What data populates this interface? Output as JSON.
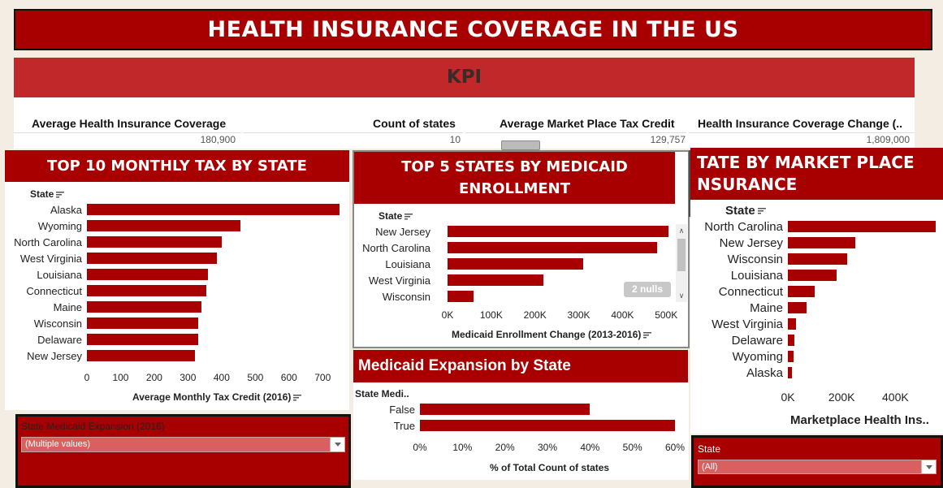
{
  "title": "HEALTH INSURANCE COVERAGE IN THE US",
  "kpi": {
    "header": "KPI",
    "items": [
      {
        "label": "Average Health Insurance Coverage",
        "value": "180,900"
      },
      {
        "label": "Count of states",
        "value": "10"
      },
      {
        "label": "Average Market Place Tax Credit",
        "value": "129,757"
      },
      {
        "label": "Health Insurance Coverage Change (..",
        "value": "1,809,000"
      }
    ]
  },
  "monthly_tax": {
    "title": "TOP 10 MONTHLY TAX BY STATE",
    "field_label": "State",
    "axis_title": "Average Monthly Tax Credit (2016)",
    "ticks": [
      "0",
      "100",
      "200",
      "300",
      "400",
      "500",
      "600",
      "700"
    ]
  },
  "medicaid_enrollment": {
    "title_line1": "TOP 5 STATES BY MEDICAID",
    "title_line2": "ENROLLMENT",
    "field_label": "State",
    "axis_title": "Medicaid Enrollment Change (2013-2016)",
    "ticks": [
      "0K",
      "100K",
      "200K",
      "300K",
      "400K",
      "500K"
    ],
    "nulls_badge": "2 nulls"
  },
  "medicaid_expansion": {
    "title": "Medicaid Expansion by State",
    "field_label": "State Medi..",
    "axis_title": "% of Total Count of states",
    "ticks": [
      "0%",
      "10%",
      "20%",
      "30%",
      "40%",
      "50%",
      "60%"
    ]
  },
  "marketplace": {
    "title_line1": "TATE BY MARKET PLACE",
    "title_line2": "NSURANCE",
    "field_label": "State",
    "axis_title": "Marketplace Health Ins..",
    "ticks": [
      "0K",
      "200K",
      "400K"
    ]
  },
  "filters": {
    "medicaid": {
      "label": "State Medicaid Expansion (2016)",
      "value": "(Multiple values)"
    },
    "state": {
      "label": "State",
      "value": "(All)"
    }
  },
  "chart_data": [
    {
      "type": "bar",
      "orientation": "horizontal",
      "title": "TOP 10 MONTHLY TAX BY STATE",
      "categories": [
        "Alaska",
        "Wyoming",
        "North Carolina",
        "West Virginia",
        "Louisiana",
        "Connecticut",
        "Maine",
        "Wisconsin",
        "Delaware",
        "New Jersey"
      ],
      "values": [
        750,
        455,
        400,
        385,
        360,
        355,
        340,
        330,
        330,
        320
      ],
      "xlabel": "Average Monthly Tax Credit (2016)",
      "ylabel": "State",
      "xlim": [
        0,
        750
      ]
    },
    {
      "type": "bar",
      "orientation": "horizontal",
      "title": "TOP 5 STATES BY MEDICAID ENROLLMENT",
      "categories": [
        "New Jersey",
        "North Carolina",
        "Louisiana",
        "West Virginia",
        "Wisconsin"
      ],
      "values": [
        505000,
        480000,
        310000,
        220000,
        60000
      ],
      "xlabel": "Medicaid Enrollment Change (2013-2016)",
      "ylabel": "State",
      "xlim": [
        0,
        520000
      ]
    },
    {
      "type": "bar",
      "orientation": "horizontal",
      "title": "Medicaid Expansion by State",
      "categories": [
        "False",
        "True"
      ],
      "values": [
        40,
        60
      ],
      "xlabel": "% of Total Count of states",
      "ylabel": "State Medi..",
      "xlim": [
        0,
        60
      ]
    },
    {
      "type": "bar",
      "orientation": "horizontal",
      "title": "TATE BY MARKET PLACE NSURANCE",
      "categories": [
        "North Carolina",
        "New Jersey",
        "Wisconsin",
        "Louisiana",
        "Connecticut",
        "Maine",
        "West Virginia",
        "Delaware",
        "Wyoming",
        "Alaska"
      ],
      "values": [
        550000,
        250000,
        220000,
        180000,
        100000,
        70000,
        30000,
        25000,
        20000,
        15000
      ],
      "xlabel": "Marketplace Health Ins..",
      "ylabel": "State",
      "xlim": [
        0,
        550000
      ]
    }
  ]
}
